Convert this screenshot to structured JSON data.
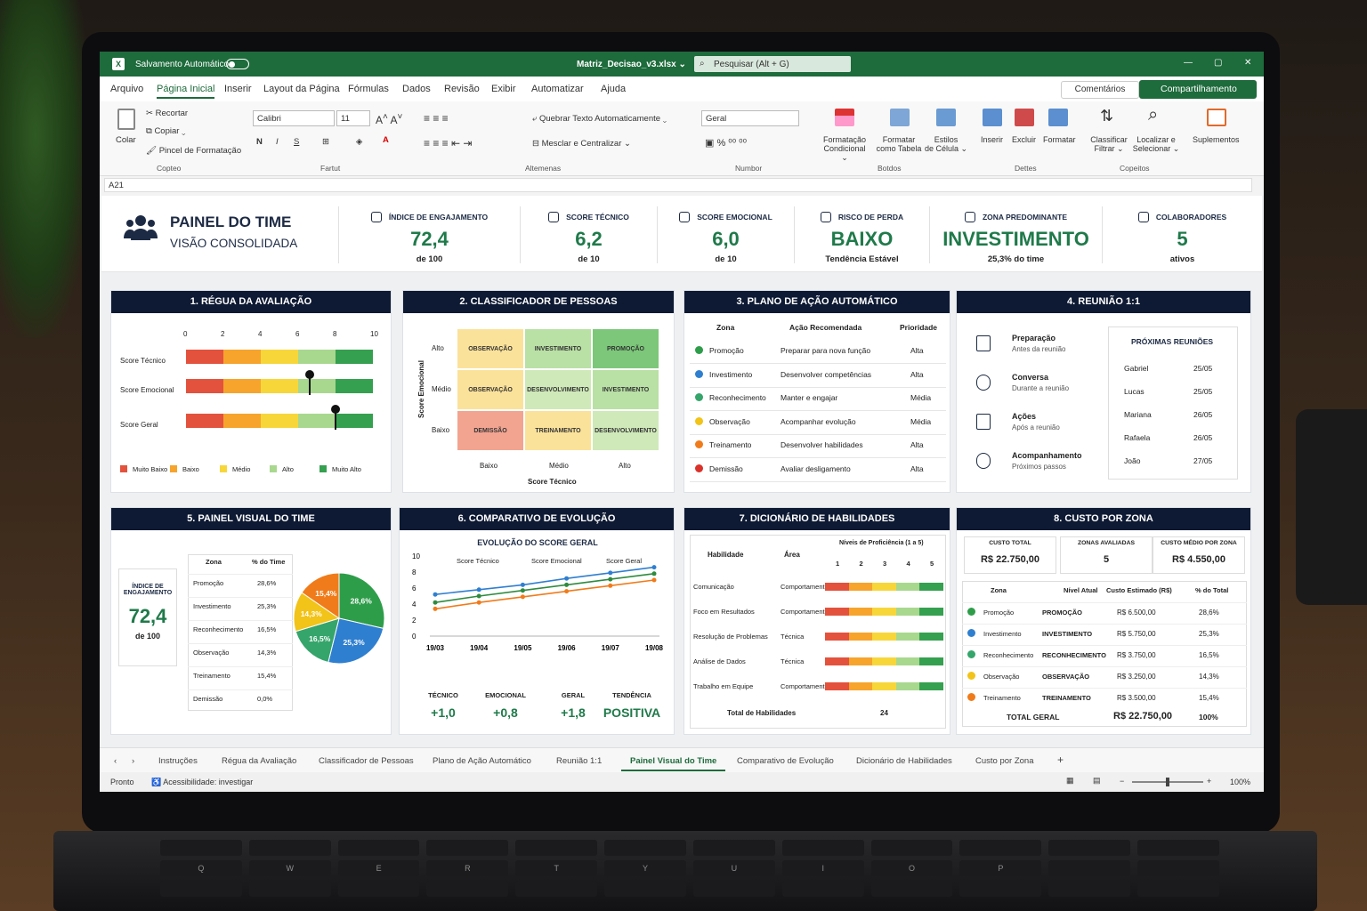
{
  "window": {
    "autosave": "Salvamento Automático",
    "filename": "Matriz_Decisao_v3.xlsx ⌄",
    "search": "Pesquisar (Alt + G)",
    "min": "—",
    "max": "▢",
    "close": "✕"
  },
  "menu": [
    "Arquivo",
    "Página Inicial",
    "Inserir",
    "Layout da Página",
    "Fórmulas",
    "Dados",
    "Revisão",
    "Exibir",
    "Automatizar",
    "Ajuda"
  ],
  "comentarios": "Comentários",
  "compartilhamento": "Compartilhamento",
  "ribbon": {
    "colar": "Colar",
    "recortar": "Recortar",
    "copiar": "Copiar ⌄",
    "pincel": "Pincel de Formatação",
    "font": "Calibri",
    "size": "11",
    "bold": "N",
    "italic": "I",
    "underline": "S",
    "wrap": "Quebrar Texto Automaticamente",
    "merge": "Mesclar e Centralizar",
    "numfmt": "Geral",
    "fmtcond1": "Formatação",
    "fmtcond2": "Condicional ⌄",
    "fmttab1": "Formatar",
    "fmttab2": "como Tabela",
    "styles1": "Estilos",
    "styles2": "de Célula ⌄",
    "inserir": "Inserir",
    "excluir": "Excluir",
    "formatar": "Formatar",
    "classificar1": "Classificar",
    "classificar2": "Filtrar ⌄",
    "localizar1": "Localizar e",
    "localizar2": "Selecionar ⌄",
    "suplementos": "Suplementos",
    "groups": [
      "Copteo",
      "Fartut",
      "Altemenas",
      "Numbor",
      "Botdos",
      "Dettes",
      "Copeitos"
    ]
  },
  "namebox": "A21",
  "header": {
    "title1": "PAINEL DO TIME",
    "title2": "VISÃO CONSOLIDADA",
    "kpis": [
      {
        "label": "ÍNDICE DE ENGAJAMENTO",
        "value": "72,4",
        "sub": "de 100",
        "icon": "gauge-icon"
      },
      {
        "label": "SCORE TÉCNICO",
        "value": "6,2",
        "sub": "de 10",
        "icon": "tools-icon"
      },
      {
        "label": "SCORE EMOCIONAL",
        "value": "6,0",
        "sub": "de 10",
        "icon": "person-icon"
      },
      {
        "label": "RISCO DE PERDA",
        "value": "BAIXO",
        "sub": "Tendência Estável",
        "icon": "warning-icon"
      },
      {
        "label": "ZONA PREDOMINANTE",
        "value": "INVESTIMENTO",
        "sub": "25,3% do time",
        "icon": "briefcase-icon"
      },
      {
        "label": "COLABORADORES",
        "value": "5",
        "sub": "ativos",
        "icon": "shield-icon"
      }
    ]
  },
  "p1": {
    "title": "1. RÉGUA DA AVALIAÇÃO",
    "ticks": [
      "0",
      "2",
      "4",
      "6",
      "8",
      "10"
    ],
    "rows": [
      "Score Técnico",
      "Score Emocional",
      "Score Geral"
    ],
    "legend": [
      "Muito Baixo",
      "Baixo",
      "Médio",
      "Alto",
      "Muito Alto"
    ],
    "markers": [
      null,
      6.6,
      8.0
    ]
  },
  "p2": {
    "title": "2. CLASSIFICADOR DE PESSOAS",
    "ylabel": "Score Emocional",
    "xlabel": "Score Técnico",
    "rows": [
      "Alto",
      "Médio",
      "Baixo"
    ],
    "cols": [
      "Baixo",
      "Médio",
      "Alto"
    ],
    "cells": [
      [
        "OBSERVAÇÃO",
        "INVESTIMENTO",
        "PROMOÇÃO"
      ],
      [
        "OBSERVAÇÃO",
        "DESENVOLVIMENTO",
        "INVESTIMENTO"
      ],
      [
        "DEMISSÃO",
        "TREINAMENTO",
        "DESENVOLVIMENTO"
      ]
    ]
  },
  "p3": {
    "title": "3. PLANO DE AÇÃO AUTOMÁTICO",
    "headers": [
      "Zona",
      "Ação Recomendada",
      "Prioridade"
    ],
    "rows": [
      [
        "Promoção",
        "Preparar para nova função",
        "Alta",
        "#2e9d4a"
      ],
      [
        "Investimento",
        "Desenvolver competências",
        "Alta",
        "#2f7fd0"
      ],
      [
        "Reconhecimento",
        "Manter e engajar",
        "Média",
        "#35a56b"
      ],
      [
        "Observação",
        "Acompanhar evolução",
        "Média",
        "#f2c318"
      ],
      [
        "Treinamento",
        "Desenvolver habilidades",
        "Alta",
        "#f07b1a"
      ],
      [
        "Demissão",
        "Avaliar desligamento",
        "Alta",
        "#d9322a"
      ]
    ]
  },
  "p4": {
    "title": "4. REUNIÃO 1:1",
    "steps": [
      [
        "Preparação",
        "Antes da reunião"
      ],
      [
        "Conversa",
        "Durante a reunião"
      ],
      [
        "Ações",
        "Após a reunião"
      ],
      [
        "Acompanhamento",
        "Próximos passos"
      ]
    ],
    "next_title": "PRÓXIMAS REUNIÕES",
    "next": [
      [
        "Gabriel",
        "25/05"
      ],
      [
        "Lucas",
        "25/05"
      ],
      [
        "Mariana",
        "26/05"
      ],
      [
        "Rafaela",
        "26/05"
      ],
      [
        "João",
        "27/05"
      ]
    ]
  },
  "p5": {
    "title": "5. PAINEL VISUAL DO TIME",
    "box_label": "ÍNDICE DE ENGAJAMENTO",
    "box_value": "72,4",
    "box_sub": "de 100",
    "headers": [
      "Zona",
      "% do Time"
    ],
    "rows": [
      [
        "Promoção",
        "28,6%"
      ],
      [
        "Investimento",
        "25,3%"
      ],
      [
        "Reconhecimento",
        "16,5%"
      ],
      [
        "Observação",
        "14,3%"
      ],
      [
        "Treinamento",
        "15,4%"
      ],
      [
        "Demissão",
        "0,0%"
      ]
    ]
  },
  "p6": {
    "title": "6. COMPARATIVO DE EVOLUÇÃO",
    "footer": [
      [
        "TÉCNICO",
        "+1,0"
      ],
      [
        "EMOCIONAL",
        "+0,8"
      ],
      [
        "GERAL",
        "+1,8"
      ],
      [
        "TENDÊNCIA",
        "POSITIVA"
      ]
    ]
  },
  "p7": {
    "title": "7. DICIONÁRIO DE HABILIDADES",
    "h1": "Habilidade",
    "h2": "Área",
    "h3": "Níveis de Proficiência (1 a 5)",
    "levels": [
      "1",
      "2",
      "3",
      "4",
      "5"
    ],
    "rows": [
      [
        "Comunicação",
        "Comportamental"
      ],
      [
        "Foco em Resultados",
        "Comportamental"
      ],
      [
        "Resolução de Problemas",
        "Técnica"
      ],
      [
        "Análise de Dados",
        "Técnica"
      ],
      [
        "Trabalho em Equipe",
        "Comportamental"
      ]
    ],
    "total_label": "Total de Habilidades",
    "total": "24"
  },
  "p8": {
    "title": "8. CUSTO POR ZONA",
    "k1l": "CUSTO TOTAL",
    "k1v": "R$ 22.750,00",
    "k2l": "ZONAS AVALIADAS",
    "k2v": "5",
    "k3l": "CUSTO MÉDIO POR ZONA",
    "k3v": "R$ 4.550,00",
    "headers": [
      "Zona",
      "Nível Atual",
      "Custo Estimado (R$)",
      "% do Total"
    ],
    "rows": [
      [
        "Promoção",
        "PROMOÇÃO",
        "R$ 6.500,00",
        "28,6%",
        "#2e9d4a"
      ],
      [
        "Investimento",
        "INVESTIMENTO",
        "R$ 5.750,00",
        "25,3%",
        "#2f7fd0"
      ],
      [
        "Reconhecimento",
        "RECONHECIMENTO",
        "R$ 3.750,00",
        "16,5%",
        "#35a56b"
      ],
      [
        "Observação",
        "OBSERVAÇÃO",
        "R$ 3.250,00",
        "14,3%",
        "#f2c318"
      ],
      [
        "Treinamento",
        "TREINAMENTO",
        "R$ 3.500,00",
        "15,4%",
        "#f07b1a"
      ]
    ],
    "total_label": "TOTAL GERAL",
    "total_value": "R$ 22.750,00",
    "total_pct": "100%"
  },
  "tabs": [
    "Instruções",
    "Régua da Avaliação",
    "Classificador de Pessoas",
    "Plano de Ação Automático",
    "Reunião 1:1",
    "Painel Visual do Time",
    "Comparativo de Evolução",
    "Dicionário de Habilidades",
    "Custo por Zona"
  ],
  "status": {
    "ready": "Pronto",
    "access": "Acessibilidade: investigar",
    "zoom": "100%"
  },
  "keys": [
    "Q",
    "W",
    "E",
    "R",
    "T",
    "Y",
    "U",
    "I",
    "O",
    "P"
  ],
  "chart_data": [
    {
      "type": "pie",
      "title": "",
      "labels": [
        "Promoção",
        "Investimento",
        "Reconhecimento",
        "Observação",
        "Treinamento"
      ],
      "values": [
        28.6,
        25.3,
        16.5,
        14.3,
        15.4
      ],
      "colors": [
        "#2e9d4a",
        "#2f7fd0",
        "#35a56b",
        "#f2c318",
        "#f07b1a"
      ]
    },
    {
      "type": "line",
      "title": "EVOLUÇÃO DO SCORE GERAL",
      "categories": [
        "19/03",
        "19/04",
        "19/05",
        "19/06",
        "19/07",
        "19/08"
      ],
      "ylim": [
        0,
        10
      ],
      "yticks": [
        "0",
        "2",
        "4",
        "6",
        "8",
        "10"
      ],
      "series": [
        {
          "name": "Score Técnico",
          "color": "#2f7fd0",
          "values": [
            5.2,
            5.8,
            6.4,
            7.2,
            7.9,
            8.6
          ]
        },
        {
          "name": "Score Emocional",
          "color": "#f07b1a",
          "values": [
            3.4,
            4.2,
            4.9,
            5.6,
            6.3,
            7.0
          ]
        },
        {
          "name": "Score Geral",
          "color": "#2e8b3e",
          "values": [
            4.2,
            5.0,
            5.7,
            6.4,
            7.1,
            7.8
          ]
        }
      ]
    }
  ]
}
